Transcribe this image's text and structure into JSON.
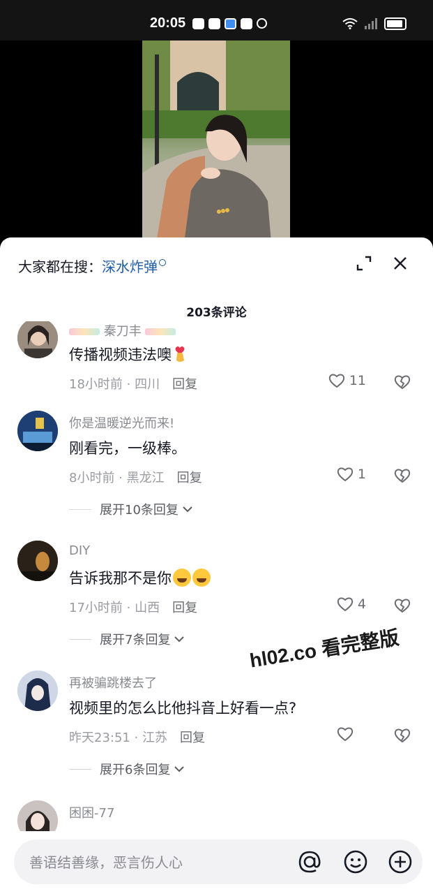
{
  "status_bar": {
    "time": "20:05"
  },
  "sheet": {
    "search_prefix": "大家都在搜：",
    "search_term": "深水炸弹",
    "comment_count": "203条评论"
  },
  "comments": [
    {
      "username": "秦刀丰",
      "text": "传播视频违法噢",
      "time": "18小时前",
      "location": "四川",
      "reply": "回复",
      "likes": "11"
    },
    {
      "username": "你是温暖逆光而来!",
      "text": "刚看完，一级棒。",
      "time": "8小时前",
      "location": "黑龙江",
      "reply": "回复",
      "likes": "1",
      "expand": "展开10条回复"
    },
    {
      "username": "DIY",
      "text": "告诉我那不是你",
      "time": "17小时前",
      "location": "山西",
      "reply": "回复",
      "likes": "4",
      "expand": "展开7条回复"
    },
    {
      "username": "再被骗跳楼去了",
      "text": "视频里的怎么比他抖音上好看一点?",
      "time": "昨天23:51",
      "location": "江苏",
      "reply": "回复",
      "likes": "",
      "expand": "展开6条回复"
    },
    {
      "username": "困困-77"
    }
  ],
  "watermark": "hl02.co 看完整版",
  "input": {
    "placeholder": "善语结善缘，恶言伤人心"
  },
  "colors": {
    "accent_link": "#1f5ea6",
    "text_primary": "#161823",
    "text_secondary": "#8a8b91"
  }
}
